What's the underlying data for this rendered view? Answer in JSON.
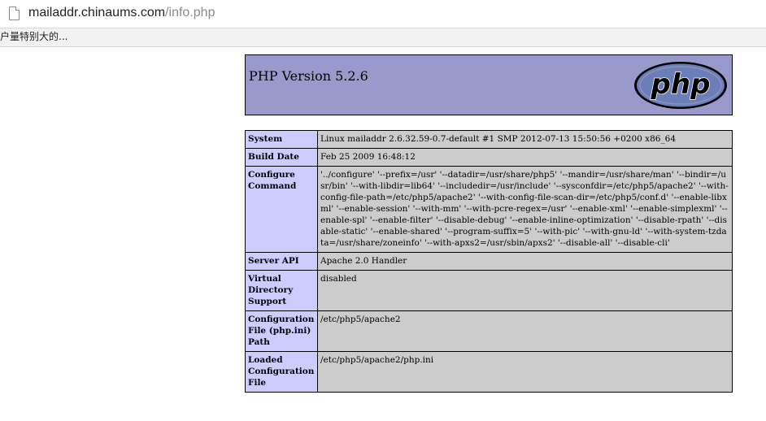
{
  "browser": {
    "url_host": "mailaddr.chinaums.com",
    "url_path": "/info.php",
    "notice": "户量特别大的..."
  },
  "php": {
    "title": "PHP Version 5.2.6",
    "logo_text": "php"
  },
  "info": {
    "rows": [
      {
        "key": "System",
        "value": "Linux mailaddr 2.6.32.59-0.7-default #1 SMP 2012-07-13 15:50:56 +0200 x86_64"
      },
      {
        "key": "Build Date",
        "value": "Feb 25 2009 16:48:12"
      },
      {
        "key": "Configure Command",
        "value": "'../configure' '--prefix=/usr' '--datadir=/usr/share/php5' '--mandir=/usr/share/man' '--bindir=/usr/bin' '--with-libdir=lib64' '--includedir=/usr/include' '--sysconfdir=/etc/php5/apache2' '--with-config-file-path=/etc/php5/apache2' '--with-config-file-scan-dir=/etc/php5/conf.d' '--enable-libxml' '--enable-session' '--with-mm' '--with-pcre-regex=/usr' '--enable-xml' '--enable-simplexml' '--enable-spl' '--enable-filter' '--disable-debug' '--enable-inline-optimization' '--disable-rpath' '--disable-static' '--enable-shared' '--program-suffix=5' '--with-pic' '--with-gnu-ld' '--with-system-tzdata=/usr/share/zoneinfo' '--with-apxs2=/usr/sbin/apxs2' '--disable-all' '--disable-cli'"
      },
      {
        "key": "Server API",
        "value": "Apache 2.0 Handler"
      },
      {
        "key": "Virtual Directory Support",
        "value": "disabled"
      },
      {
        "key": "Configuration File (php.ini) Path",
        "value": "/etc/php5/apache2"
      },
      {
        "key": "Loaded Configuration File",
        "value": "/etc/php5/apache2/php.ini"
      }
    ]
  },
  "colors": {
    "header_bg": "#9999cc",
    "key_bg": "#ccccff",
    "value_bg": "#cccccc",
    "logo_fill": "#6c7eb7"
  }
}
